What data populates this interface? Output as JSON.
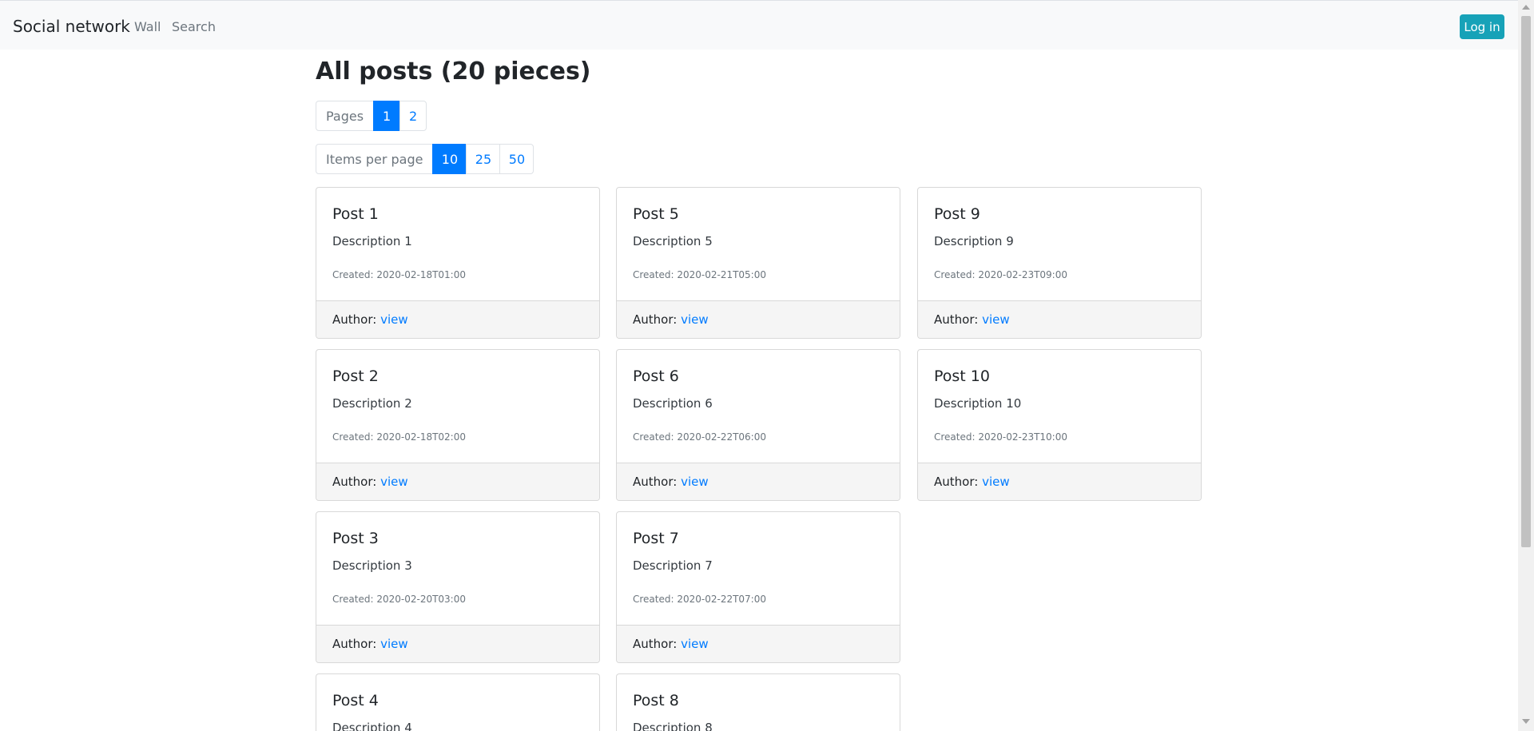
{
  "navbar": {
    "brand": "Social network",
    "links": [
      "Wall",
      "Search"
    ],
    "login_label": "Log in"
  },
  "main": {
    "title": "All posts (20 pieces)",
    "pages": {
      "label": "Pages",
      "items": [
        "1",
        "2"
      ],
      "active": "1"
    },
    "per_page": {
      "label": "Items per page",
      "items": [
        "10",
        "25",
        "50"
      ],
      "active": "10"
    }
  },
  "posts": [
    {
      "title": "Post 1",
      "description": "Description 1",
      "created": "Created: 2020-02-18T01:00",
      "author_label": "Author:",
      "author_link": "view"
    },
    {
      "title": "Post 2",
      "description": "Description 2",
      "created": "Created: 2020-02-18T02:00",
      "author_label": "Author:",
      "author_link": "view"
    },
    {
      "title": "Post 3",
      "description": "Description 3",
      "created": "Created: 2020-02-20T03:00",
      "author_label": "Author:",
      "author_link": "view"
    },
    {
      "title": "Post 4",
      "description": "Description 4",
      "created": "",
      "author_label": "",
      "author_link": ""
    },
    {
      "title": "Post 5",
      "description": "Description 5",
      "created": "Created: 2020-02-21T05:00",
      "author_label": "Author:",
      "author_link": "view"
    },
    {
      "title": "Post 6",
      "description": "Description 6",
      "created": "Created: 2020-02-22T06:00",
      "author_label": "Author:",
      "author_link": "view"
    },
    {
      "title": "Post 7",
      "description": "Description 7",
      "created": "Created: 2020-02-22T07:00",
      "author_label": "Author:",
      "author_link": "view"
    },
    {
      "title": "Post 8",
      "description": "Description 8",
      "created": "",
      "author_label": "",
      "author_link": ""
    },
    {
      "title": "Post 9",
      "description": "Description 9",
      "created": "Created: 2020-02-23T09:00",
      "author_label": "Author:",
      "author_link": "view"
    },
    {
      "title": "Post 10",
      "description": "Description 10",
      "created": "Created: 2020-02-23T10:00",
      "author_label": "Author:",
      "author_link": "view"
    }
  ]
}
